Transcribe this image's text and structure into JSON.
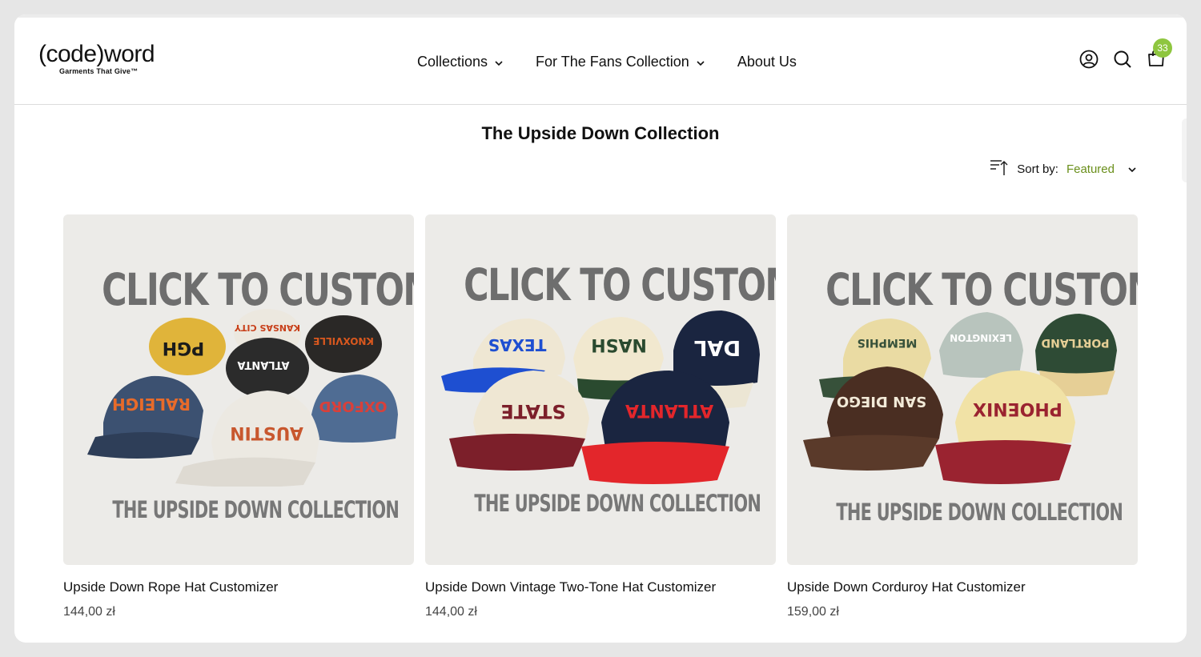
{
  "header": {
    "logo_main": "(code)word",
    "logo_tag": "Garments That Give™",
    "nav": [
      {
        "label": "Collections",
        "has_dropdown": true
      },
      {
        "label": "For The Fans Collection",
        "has_dropdown": true
      },
      {
        "label": "About Us",
        "has_dropdown": false
      }
    ],
    "icons": [
      "account-icon",
      "search-icon",
      "cart-icon"
    ],
    "cart_count": "33"
  },
  "page": {
    "title": "The Upside Down Collection",
    "sort_label": "Sort by:",
    "sort_value": "Featured"
  },
  "colors": {
    "accent_green": "#8ec63f",
    "sort_value": "#6a8f1b"
  },
  "products": [
    {
      "image_cta": "CLICK TO CUSTOMIZE",
      "image_sub": "THE UPSIDE DOWN COLLECTION",
      "name": "Upside Down Rope Hat Customizer",
      "price": "144,00 zł",
      "cap_texts": [
        "PGH",
        "KANSAS CITY",
        "KNOXVILLE",
        "ATLANTA",
        "RALEIGH",
        "OXFORD",
        "AUSTIN"
      ]
    },
    {
      "image_cta": "CLICK TO CUSTOMIZE",
      "image_sub": "THE UPSIDE DOWN COLLECTION",
      "name": "Upside Down Vintage Two-Tone Hat Customizer",
      "price": "144,00 zł",
      "cap_texts": [
        "TEXAS",
        "NASH",
        "DAL",
        "STATE",
        "ATLANTA"
      ]
    },
    {
      "image_cta": "CLICK TO CUSTOMIZE",
      "image_sub": "THE UPSIDE DOWN COLLECTION",
      "name": "Upside Down Corduroy Hat Customizer",
      "price": "159,00 zł",
      "cap_texts": [
        "MEMPHIS",
        "LEXINGTON",
        "PORTLAND",
        "SAN DIEGO",
        "PHOENIX"
      ]
    }
  ]
}
